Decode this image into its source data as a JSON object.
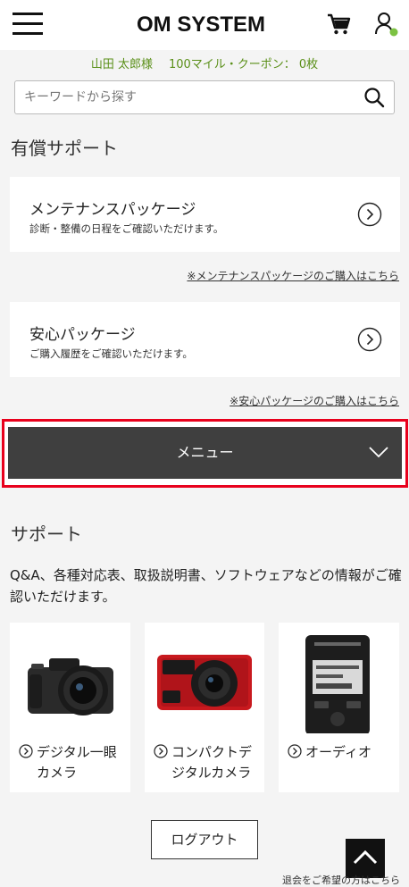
{
  "header": {
    "logo": "OM SYSTEM",
    "menu_icon": "hamburger-menu-icon",
    "cart_icon": "cart-icon",
    "user_icon": "user-icon",
    "status_dot_color": "#7cc242"
  },
  "member": {
    "name": "山田 太郎様",
    "points": "100マイル・クーポン： 0枚"
  },
  "search": {
    "placeholder": "キーワードから探す",
    "value": ""
  },
  "paid_support": {
    "title": "有償サポート",
    "cards": [
      {
        "title": "メンテナンスパッケージ",
        "desc": "診断・整備の日程をご確認いただけます。",
        "link": "※メンテナンスパッケージのご購入はこちら"
      },
      {
        "title": "安心パッケージ",
        "desc": "ご購入履歴をご確認いただけます。",
        "link": "※安心パッケージのご購入はこちら"
      }
    ]
  },
  "menu_bar": {
    "label": "メニュー",
    "highlight_color": "#e8001c"
  },
  "support": {
    "title": "サポート",
    "desc": "Q&A、各種対応表、取扱説明書、ソフトウェアなどの情報がご確認いただけます。",
    "categories": [
      {
        "line1": "デジタル一眼",
        "line2": "カメラ"
      },
      {
        "line1": "コンパクトデ",
        "line2": "ジタルカメラ"
      },
      {
        "line1": "オーディオ",
        "line2": ""
      }
    ]
  },
  "footer": {
    "logout": "ログアウト",
    "withdraw": "退会をご希望の方はこちら"
  },
  "colors": {
    "accent_green": "#5a8f18",
    "menu_bg": "#3f3f3f",
    "page_bg": "#f4f4f4"
  }
}
